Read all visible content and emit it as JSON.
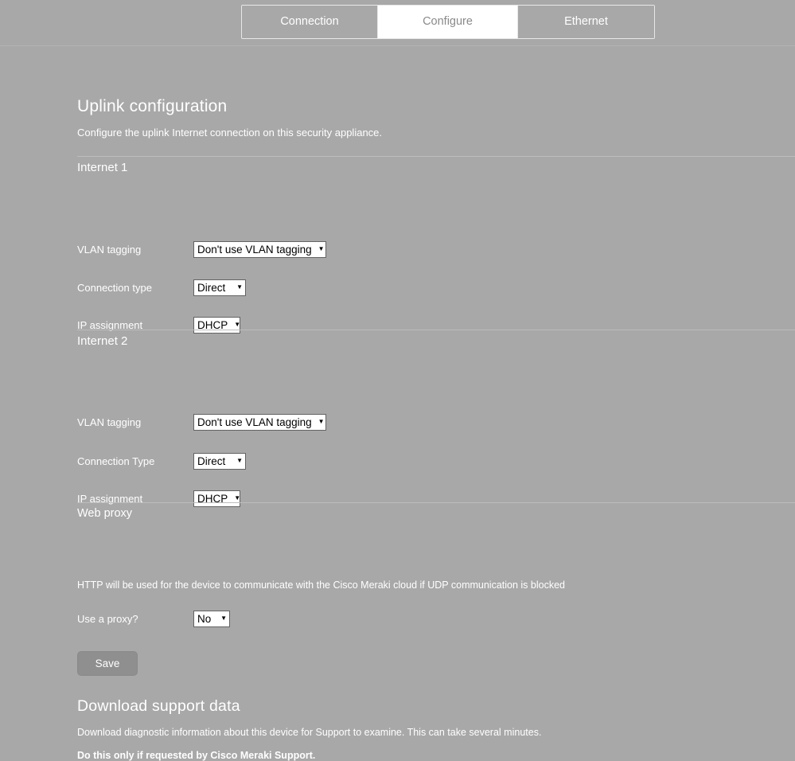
{
  "tabs": [
    {
      "id": "connection",
      "label": "Connection",
      "active": false
    },
    {
      "id": "configure",
      "label": "Configure",
      "active": true
    },
    {
      "id": "ethernet",
      "label": "Ethernet",
      "active": false
    }
  ],
  "page": {
    "title": "Uplink configuration",
    "subtitle": "Configure the uplink Internet connection on this security appliance."
  },
  "internet1": {
    "heading": "Internet 1",
    "vlan_label": "VLAN tagging",
    "vlan_value": "Don't use VLAN tagging",
    "conn_label": "Connection type",
    "conn_value": "Direct",
    "ip_label": "IP assignment",
    "ip_value": "DHCP"
  },
  "internet2": {
    "heading": "Internet 2",
    "vlan_label": "VLAN tagging",
    "vlan_value": "Don't use VLAN tagging",
    "conn_label": "Connection Type",
    "conn_value": "Direct",
    "ip_label": "IP assignment",
    "ip_value": "DHCP"
  },
  "webproxy": {
    "heading": "Web proxy",
    "description": "HTTP will be used for the device to communicate with the Cisco Meraki cloud if UDP communication is blocked",
    "proxy_label": "Use a proxy?",
    "proxy_value": "No"
  },
  "actions": {
    "save_label": "Save"
  },
  "support": {
    "title": "Download support data",
    "description": "Download diagnostic information about this device for Support to examine. This can take several minutes.",
    "warning": "Do this only if requested by Cisco Meraki Support."
  },
  "icons": {
    "caret": "▼"
  },
  "colors": {
    "page_background": "#a8a8a8",
    "text": "#ffffff",
    "select_background": "#ffffff",
    "select_text": "#000000",
    "select_border": "#636363",
    "active_tab_background": "#ffffff",
    "active_tab_text": "#8a8a8a",
    "save_button_background": "#8f8f8f",
    "divider": "#bdbdbd"
  }
}
